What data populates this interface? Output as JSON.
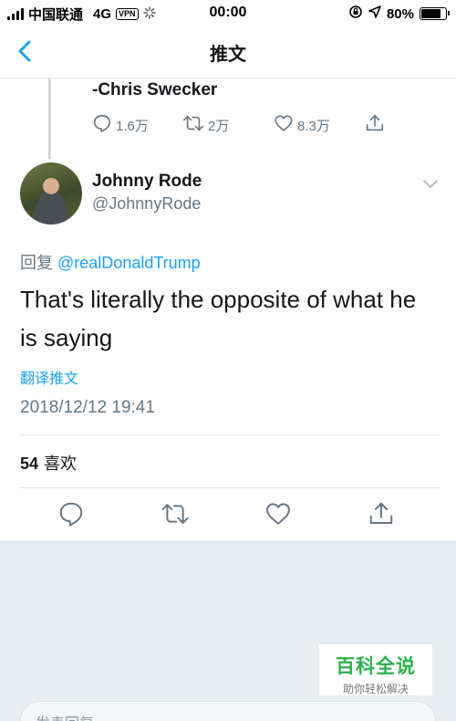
{
  "status_bar": {
    "carrier": "中国联通",
    "network": "4G",
    "vpn": "VPN",
    "time": "00:00",
    "battery": "80%",
    "battery_level": 0.8
  },
  "nav": {
    "title": "推文"
  },
  "previous_tweet": {
    "quote_tail": "-Chris Swecker",
    "replies": "1.6万",
    "retweets": "2万",
    "likes": "8.3万"
  },
  "tweet": {
    "author_name": "Johnny Rode",
    "author_handle": "@JohnnyRode",
    "reply_prefix": "回复",
    "reply_mention": "@realDonaldTrump",
    "text": "That's literally the opposite of what he is saying",
    "translate_label": "翻译推文",
    "timestamp": "2018/12/12 19:41",
    "likes_count": "54",
    "likes_label": "喜欢"
  },
  "reply_box": {
    "placeholder": "发表回复"
  },
  "watermark": {
    "title": "百科全说",
    "subtitle": "助你轻松解决"
  },
  "colors": {
    "accent": "#1da1f2",
    "secondary_text": "#657786",
    "background_gray": "#e6ecf0"
  }
}
